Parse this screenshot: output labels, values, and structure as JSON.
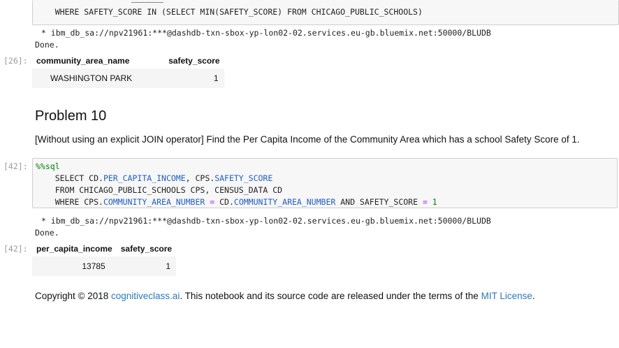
{
  "cell_prev": {
    "code_tail": "    WHERE SAFETY_SCORE IN (SELECT MIN(SAFETY_SCORE) FROM CHICAGO_PUBLIC_SCHOOLS)",
    "conn_line": " * ibm_db_sa://npv21961:***@dashdb-txn-sbox-yp-lon02-02.services.eu-gb.bluemix.net:50000/BLUDB",
    "done": "Done.",
    "out_prompt": "[26]:",
    "table": {
      "headers": [
        "community_area_name",
        "safety_score"
      ],
      "rows": [
        [
          "WASHINGTON PARK",
          "1"
        ]
      ]
    }
  },
  "problem": {
    "title": "Problem 10",
    "description": "[Without using an explicit JOIN operator] Find the Per Capita Income of the Community Area which has a school Safety Score of 1."
  },
  "cell_42": {
    "in_prompt": "[42]:",
    "magic": "%%sql",
    "line1_a": "    SELECT CD.",
    "line1_b": "PER_CAPITA_INCOME",
    "line1_c": ", CPS.",
    "line1_d": "SAFETY_SCORE",
    "line2": "    FROM CHICAGO_PUBLIC_SCHOOLS CPS, CENSUS_DATA CD",
    "line3_a": "    WHERE CPS.",
    "line3_b": "COMMUNITY_AREA_NUMBER",
    "line3_c": " = ",
    "line3_d": "CD.",
    "line3_e": "COMMUNITY_AREA_NUMBER",
    "line3_f": " AND SAFETY_SCORE ",
    "line3_g": "=",
    "line3_h": " 1",
    "conn_line": " * ibm_db_sa://npv21961:***@dashdb-txn-sbox-yp-lon02-02.services.eu-gb.bluemix.net:50000/BLUDB",
    "done": "Done.",
    "out_prompt": "[42]:",
    "table": {
      "headers": [
        "per_capita_income",
        "safety_score"
      ],
      "rows": [
        [
          "13785",
          "1"
        ]
      ]
    }
  },
  "footer": {
    "prefix": "Copyright © 2018 ",
    "link1": "cognitiveclass.ai",
    "middle": ". This notebook and its source code are released under the terms of the ",
    "link2": "MIT License",
    "suffix": "."
  }
}
